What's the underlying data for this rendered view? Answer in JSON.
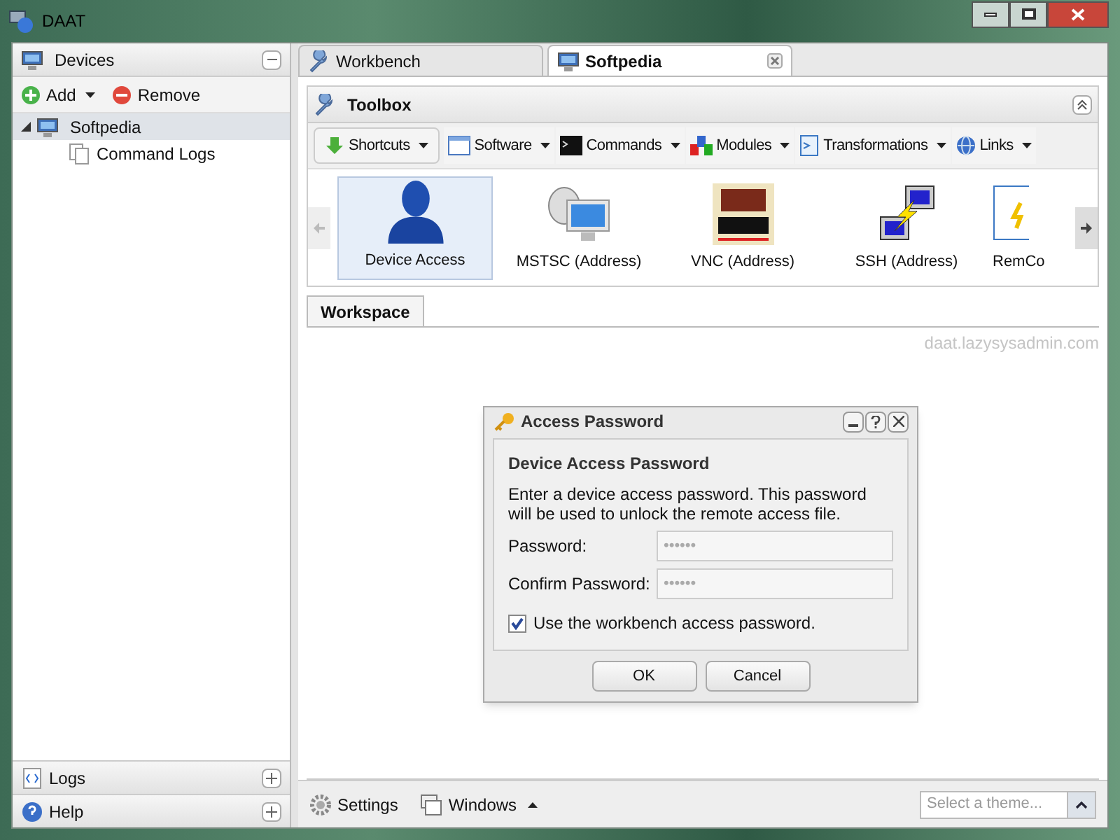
{
  "window": {
    "title": "DAAT"
  },
  "sidebar": {
    "title": "Devices",
    "actions": [
      {
        "kind": "add",
        "label": "Add",
        "has_menu": true
      },
      {
        "kind": "remove",
        "label": "Remove",
        "has_menu": false
      }
    ],
    "tree": [
      {
        "label": "Softpedia",
        "kind": "device",
        "expanded": true,
        "selected": true,
        "children": [
          {
            "label": "Command Logs",
            "selected": false
          }
        ]
      }
    ],
    "panels": [
      {
        "kind": "logs",
        "label": "Logs"
      },
      {
        "kind": "help",
        "label": "Help"
      }
    ]
  },
  "tabs": [
    {
      "label": "Workbench",
      "kind": "wrench",
      "selected": false,
      "closable": false
    },
    {
      "label": "Softpedia",
      "kind": "device",
      "selected": true,
      "closable": true
    }
  ],
  "toolbox": {
    "title": "Toolbox",
    "menus": [
      {
        "kind": "shortcuts",
        "label": "Shortcuts"
      },
      {
        "kind": "software",
        "label": "Software"
      },
      {
        "kind": "commands",
        "label": "Commands"
      },
      {
        "kind": "modules",
        "label": "Modules"
      },
      {
        "kind": "transformations",
        "label": "Transformations"
      },
      {
        "kind": "links",
        "label": "Links"
      }
    ],
    "items": [
      {
        "kind": "person",
        "label": "Device Access",
        "selected": true
      },
      {
        "kind": "satellite",
        "label": "MSTSC (Address)",
        "selected": false
      },
      {
        "kind": "vnc",
        "label": "VNC (Address)",
        "selected": false
      },
      {
        "kind": "ssh",
        "label": "SSH (Address)",
        "selected": false
      },
      {
        "kind": "remcom",
        "label": "RemCo",
        "selected": false
      }
    ]
  },
  "workspace": {
    "tab": "Workspace",
    "url": "daat.lazysysadmin.com"
  },
  "dialog": {
    "title": "Access Password",
    "heading": "Device Access Password",
    "message": "Enter a device access password. This password will be used to unlock the remote access file.",
    "fields": [
      {
        "label": "Password:",
        "value": "••••••"
      },
      {
        "label": "Confirm Password:",
        "value": "••••••"
      }
    ],
    "checkbox": {
      "label": "Use the workbench access password.",
      "checked": true
    },
    "buttons": [
      "OK",
      "Cancel"
    ]
  },
  "status_bar": {
    "settings": "Settings",
    "windows": "Windows",
    "theme_placeholder": "Select a theme..."
  }
}
